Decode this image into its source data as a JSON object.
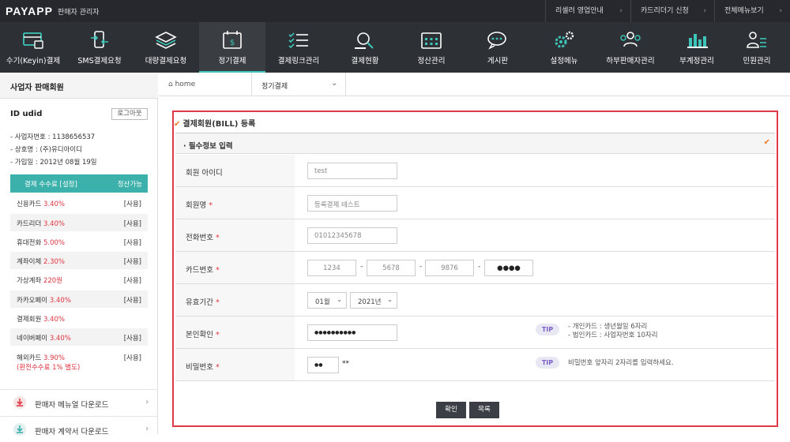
{
  "topbar": {
    "logo": "PAYAPP",
    "admin": "판매자 관리자",
    "links": [
      {
        "label": "리셀러 영업안내",
        "arrow": "›"
      },
      {
        "label": "카드리더기 신청",
        "arrow": "›"
      },
      {
        "label": "전체메뉴보기",
        "arrow": "›"
      }
    ]
  },
  "nav": {
    "items": [
      {
        "label": "수기(Keyin)결제",
        "icon": "card-screen-icon"
      },
      {
        "label": "SMS결제요청",
        "icon": "phone-arrows-icon"
      },
      {
        "label": "대량결제요청",
        "icon": "layers-icon"
      },
      {
        "label": "정기결제",
        "icon": "calendar-dollar-icon"
      },
      {
        "label": "결제링크관리",
        "icon": "checklist-icon"
      },
      {
        "label": "결제현황",
        "icon": "search-chart-icon"
      },
      {
        "label": "정산관리",
        "icon": "calendar-grid-icon"
      },
      {
        "label": "게시판",
        "icon": "chat-bubbles-icon"
      },
      {
        "label": "설정메뉴",
        "icon": "gears-icon"
      },
      {
        "label": "하부판매자관리",
        "icon": "users-icon"
      },
      {
        "label": "부계정관리",
        "icon": "bar-chart-icon"
      },
      {
        "label": "민원관리",
        "icon": "person-list-icon"
      }
    ],
    "active_label": "정기결제"
  },
  "sidebar": {
    "title": "사업자 판매회원",
    "id_label": "ID  udid",
    "logout": "로그아웃",
    "info": [
      "- 사업자번호 : 1138656537",
      "- 상호명 : (주)유디아이디",
      "- 가입일 : 2012년 08월 19일"
    ],
    "fee_header": {
      "left": "결제 수수료 [설정]",
      "right": "정산가능"
    },
    "fees": [
      {
        "name": "신용카드",
        "rate": "3.40%",
        "use": "[사용]"
      },
      {
        "name": "카드리더",
        "rate": "3.40%",
        "use": "[사용]"
      },
      {
        "name": "휴대전화",
        "rate": "5.00%",
        "use": "[사용]"
      },
      {
        "name": "계좌이체",
        "rate": "2.30%",
        "use": "[사용]"
      },
      {
        "name": "가상계좌",
        "rate": "220원",
        "use": "[사용]"
      },
      {
        "name": "카카오페이",
        "rate": "3.40%",
        "use": "[사용]"
      },
      {
        "name": "결제회원",
        "rate": "3.40%",
        "use": ""
      },
      {
        "name": "네이버페이",
        "rate": "3.40%",
        "use": "[사용]"
      },
      {
        "name": "해외카드",
        "rate": "3.90%",
        "use": "[사용]",
        "note": "(환전수수료 1% 별도)"
      }
    ],
    "downloads": [
      {
        "label": "판매자 메뉴얼 다운로드",
        "arrow": "›"
      },
      {
        "label": "판매자 계약서 다운로드",
        "arrow": "›"
      }
    ]
  },
  "breadcrumb": {
    "home": "home",
    "current": "정기결제",
    "chevron": "⌄"
  },
  "form": {
    "title": "결제회원(BILL) 등록",
    "section": "· 필수정보 입력",
    "check": "✔",
    "fields": {
      "member_id": {
        "label": "회원 아이디",
        "placeholder": "test"
      },
      "member_name": {
        "label": "회원명",
        "placeholder": "등록결제 테스트"
      },
      "phone": {
        "label": "전화번호",
        "placeholder": "01012345678"
      },
      "card": {
        "label": "카드번호",
        "parts": [
          "1234",
          "5678",
          "9876",
          "●●●●"
        ],
        "dash": "-"
      },
      "expiry": {
        "label": "유효기간",
        "month": "01월",
        "year": "2021년"
      },
      "identity": {
        "label": "본인확인",
        "value": "●●●●●●●●●●",
        "tip": "TIP",
        "tip_lines": [
          "- 개인카드 : 생년월일 6자리",
          "- 법인카드 : 사업자번호 10자리"
        ]
      },
      "password": {
        "label": "비밀번호",
        "value": "●●",
        "suffix": "**",
        "tip": "TIP",
        "tip_text": "비밀번호 앞자리 2자리를 입력하세요."
      }
    },
    "required_mark": "*",
    "buttons": {
      "confirm": "확인",
      "list": "목록"
    }
  }
}
